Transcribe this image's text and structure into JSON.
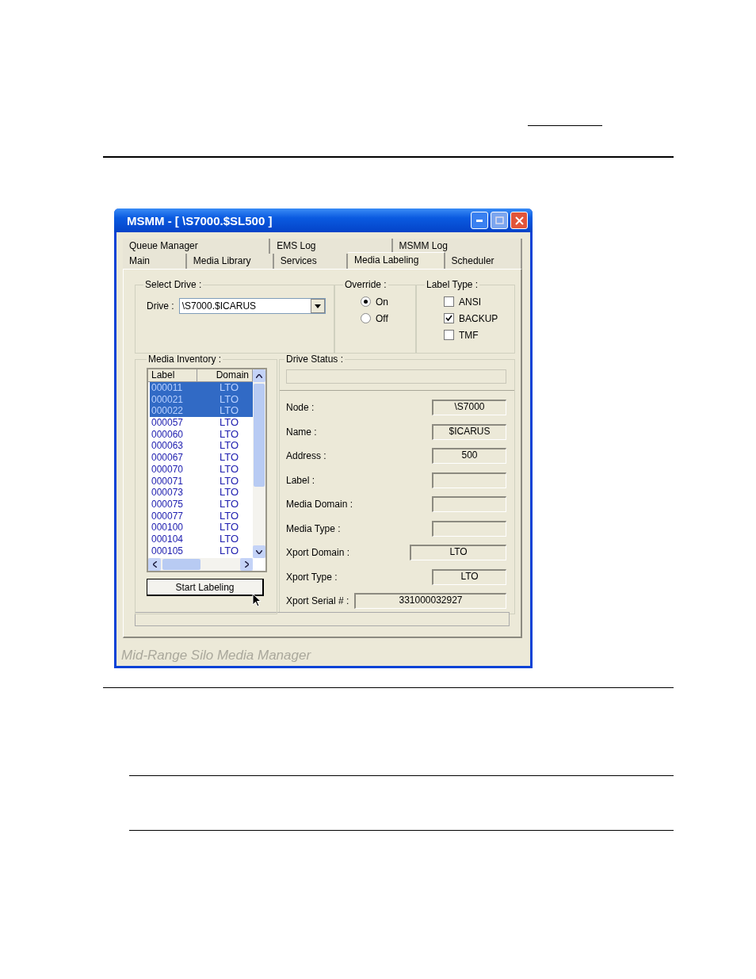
{
  "window": {
    "title": "MSMM - [ \\S7000.$SL500 ]"
  },
  "tab_rows": [
    [
      {
        "label": "Queue Manager",
        "selected": false
      },
      {
        "label": "EMS Log",
        "selected": false
      },
      {
        "label": "MSMM Log",
        "selected": false
      }
    ],
    [
      {
        "label": "Main",
        "selected": false
      },
      {
        "label": "Media Library",
        "selected": false
      },
      {
        "label": "Services",
        "selected": false
      },
      {
        "label": "Media Labeling",
        "selected": true
      },
      {
        "label": "Scheduler",
        "selected": false
      }
    ]
  ],
  "select_drive": {
    "title": "Select Drive :",
    "label": "Drive :",
    "value": "\\S7000.$ICARUS"
  },
  "override": {
    "title": "Override :",
    "options": [
      {
        "label": "On",
        "selected": true
      },
      {
        "label": "Off",
        "selected": false
      }
    ]
  },
  "label_type": {
    "title": "Label Type :",
    "options": [
      {
        "label": "ANSI",
        "checked": false
      },
      {
        "label": "BACKUP",
        "checked": true
      },
      {
        "label": "TMF",
        "checked": false
      }
    ]
  },
  "media_inventory": {
    "title": "Media Inventory :",
    "columns": [
      "Label",
      "Domain"
    ],
    "rows": [
      {
        "label": "000011",
        "domain": "LTO",
        "selected": true
      },
      {
        "label": "000021",
        "domain": "LTO",
        "selected": true
      },
      {
        "label": "000022",
        "domain": "LTO",
        "selected": true
      },
      {
        "label": "000057",
        "domain": "LTO",
        "selected": false
      },
      {
        "label": "000060",
        "domain": "LTO",
        "selected": false
      },
      {
        "label": "000063",
        "domain": "LTO",
        "selected": false
      },
      {
        "label": "000067",
        "domain": "LTO",
        "selected": false
      },
      {
        "label": "000070",
        "domain": "LTO",
        "selected": false
      },
      {
        "label": "000071",
        "domain": "LTO",
        "selected": false
      },
      {
        "label": "000073",
        "domain": "LTO",
        "selected": false
      },
      {
        "label": "000075",
        "domain": "LTO",
        "selected": false
      },
      {
        "label": "000077",
        "domain": "LTO",
        "selected": false
      },
      {
        "label": "000100",
        "domain": "LTO",
        "selected": false
      },
      {
        "label": "000104",
        "domain": "LTO",
        "selected": false
      },
      {
        "label": "000105",
        "domain": "LTO",
        "selected": false
      }
    ],
    "button": "Start Labeling"
  },
  "drive_status": {
    "title": "Drive Status :",
    "fields": [
      {
        "label": "Node :",
        "value": "\\S7000"
      },
      {
        "label": "Name :",
        "value": "$ICARUS"
      },
      {
        "label": "Address :",
        "value": "500"
      },
      {
        "label": "Label :"
      },
      {
        "label": "Media Domain :"
      },
      {
        "label": "Media Type :"
      },
      {
        "label": "Xport Domain :",
        "value": "LTO"
      },
      {
        "label": "Xport Type :",
        "value": "LTO"
      },
      {
        "label": "Xport Serial # :",
        "value": "331000032927"
      }
    ]
  },
  "footer": "Mid-Range Silo Media Manager"
}
